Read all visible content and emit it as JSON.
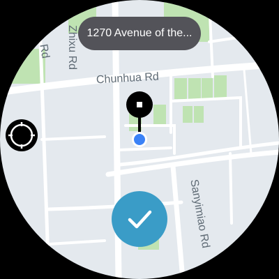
{
  "address": {
    "text": "1270 Avenue of the..."
  },
  "map": {
    "streets": {
      "chunhua": "Chunhua Rd",
      "zhixu": "Zhixu Rd",
      "sanyimiao": "Sanyimiao Rd",
      "rd_left": "Rd"
    }
  },
  "icons": {
    "recenter": "crosshair-icon",
    "confirm": "checkmark-icon",
    "pin": "location-pin-icon",
    "current": "current-location-dot-icon"
  },
  "colors": {
    "map_background": "#e4e9ee",
    "road": "#ffffff",
    "park": "#bfe3b2",
    "address_pill": "#535359",
    "confirm_button": "#3a9cc7",
    "current_location": "#3b82f6"
  }
}
